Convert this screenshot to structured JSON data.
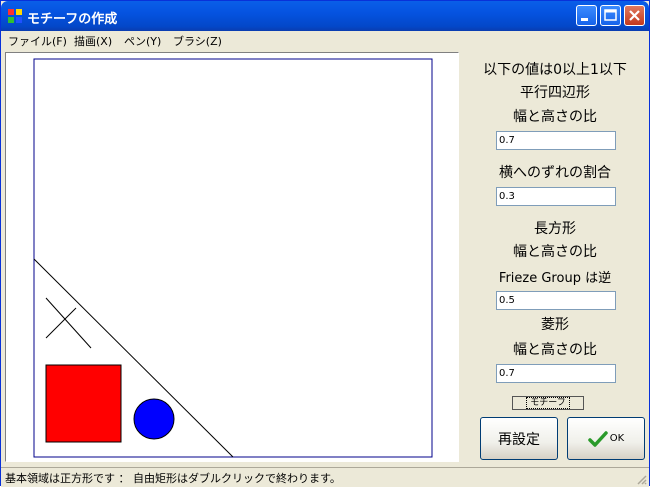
{
  "window": {
    "title": "モチーフの作成"
  },
  "menu": [
    {
      "label": "ファイル(F)"
    },
    {
      "label": "描画(X)"
    },
    {
      "label": "ペン(Y)"
    },
    {
      "label": "ブラシ(Z)"
    }
  ],
  "panel": {
    "header": "以下の値は0以上1以下",
    "parallelogram_label": "平行四辺形",
    "ratio_label_1": "幅と高さの比",
    "parallelogram_ratio": "0.7",
    "shift_label": "横へのずれの割合",
    "shift_value": "0.3",
    "rectangle_label": "長方形",
    "ratio_label_2": "幅と高さの比",
    "frieze_label": "Frieze Group は逆",
    "rectangle_ratio": "0.5",
    "rhombus_label": "菱形",
    "ratio_label_3": "幅と高さの比",
    "rhombus_ratio": "0.7",
    "motif_button": "モチーフ",
    "reset_button": "再設定",
    "ok_button": "OK"
  },
  "status": {
    "text": "基本領域は正方形です ： 自由矩形はダブルクリックで終わります。"
  },
  "colors": {
    "square": "#ff0000",
    "circle": "#0000ff",
    "frame": "#00008b"
  }
}
